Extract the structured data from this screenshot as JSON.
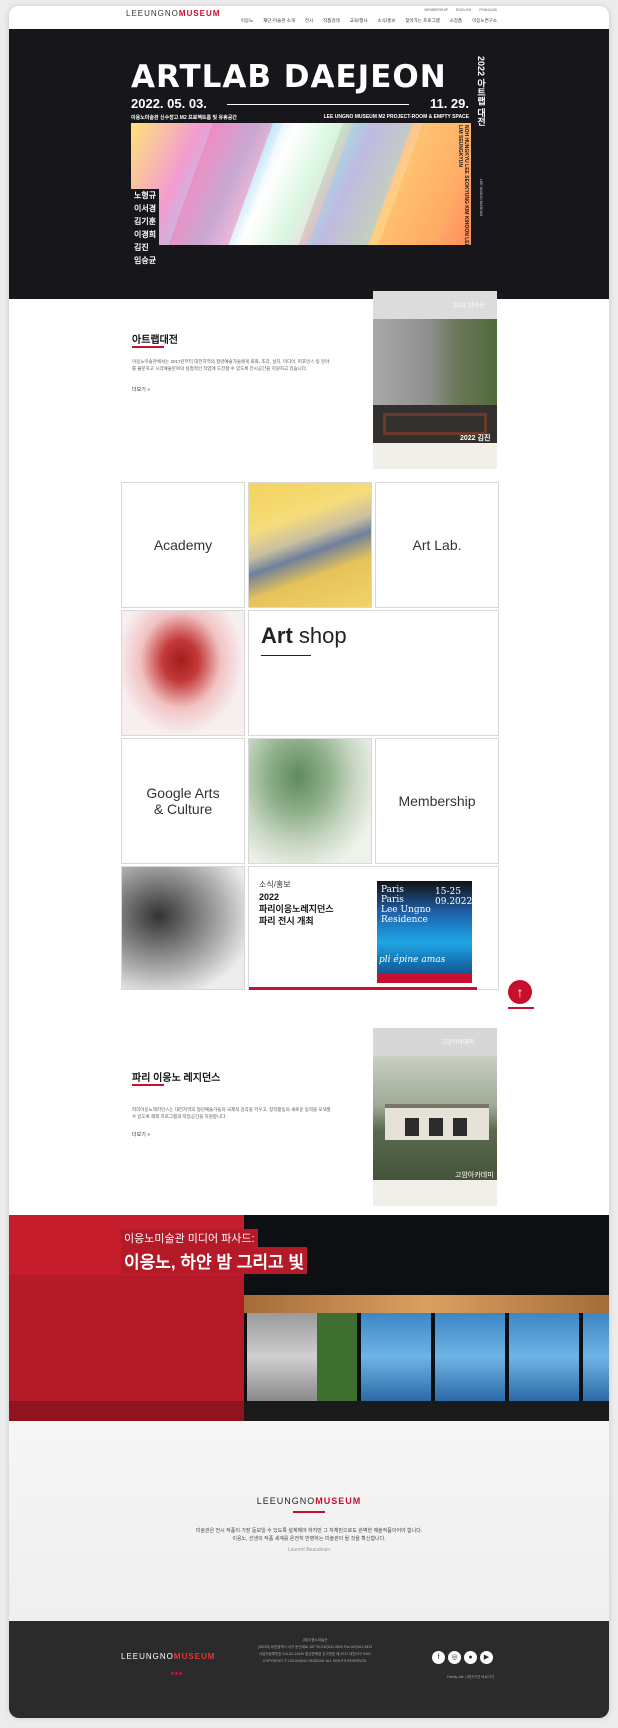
{
  "header": {
    "logo_prefix": "LEEUNGNO",
    "logo_suffix": "MUSEUM",
    "top_links": [
      "MEMBERSHIP",
      "ENGLISH",
      "FRANÇAIS"
    ],
    "nav": [
      "이응노",
      "재단·미술관 소개",
      "전시",
      "작품검색",
      "교육/행사",
      "소식/홍보",
      "찾아가는 프로그램",
      "소장품",
      "이응노연구소"
    ]
  },
  "hero": {
    "title": "ARTLAB DAEJEON",
    "date_start": "2022. 05. 03.",
    "date_end": "11. 29.",
    "subtitle_left": "이응노미술관 신수장고 M2 프로젝트룸 및 유휴공간",
    "subtitle_right": "LEE UNGNO MUSEUM  M2 PROJECT-ROOM & EMPTY SPACE",
    "artists": [
      "노형규",
      "이서경",
      "김기훈",
      "이경희",
      "김진",
      "임승균"
    ],
    "vertical_title": "2022 아트랩 대전",
    "vertical_names": "NOH HUNGKYU  LEE SEOKYUNG  KIM KIHOON  LEE KYUNGHEE  KIM JIN  LIM SEUNGKYUN",
    "vertical_small": "LEE UNGNO MUSEUM"
  },
  "section1": {
    "title": "아트랩대전",
    "text": "이응노미술관에서는 2017년부터 대전지역의 청년예술가들에게 회화, 조각, 설치, 미디어, 퍼포먼스 등 분야를 불문하고 시각예술분야의 실험적인 작업에 도전할 수 있도록 전시공간을 지원하고 있습니다.",
    "more": "더보기 »",
    "photo_top_label": "2022 임승균",
    "photo_bottom_label": "2022 김진"
  },
  "grid": {
    "academy": "Academy",
    "artlab": "Art Lab.",
    "artshop_bold": "Art",
    "artshop_rest": " shop",
    "google": "Google Arts\n& Culture",
    "membership": "Membership",
    "news_kicker": "소식/홍보",
    "news_title": "2022\n파리이응노레지던스\n파리 전시 개최",
    "news_img_text_1": "Paris\nParis\nLee Ungno\nResidence",
    "news_img_text_2": "15-25\n09.2022",
    "news_img_text_3": "pli épine amas"
  },
  "scroll_top": "↑",
  "section2": {
    "title": "파리 이응노 레지던스",
    "text": "파리이응노레지던스는 대전지역의 청년예술가들의 국제적 감각을 키우고, 창작활동의 새로운 동력을 모색할 수 있도록 해외 프로그램과 작업공간을 지원합니다.",
    "more": "더보기 »",
    "photo_top_label": "고암아카데미",
    "photo_bottom_label": "고암아카데미"
  },
  "facade": {
    "kicker": "이응노미술관 미디어 파사드:",
    "title": "이응노, 하얀 밤 그리고 빛"
  },
  "quote": {
    "logo_prefix": "LEEUNGNO",
    "logo_suffix": "MUSEUM",
    "line1": "미술관은 전시 작품이 가장 돋보일 수 있도록 설계해야 하지만 그 자체만으로도 완벽한 예술작품이어야 합니다.",
    "line2": "이응노, 선생의 작품 세계를 온전히 반영하는 미술관이 될 것을 확신합니다.",
    "author": "Laurent Beaudouin"
  },
  "footer": {
    "logo_prefix": "LEEUNGNO",
    "logo_suffix": "MUSEUM",
    "info_lines": [
      "(재)이응노미술관",
      "(35203) 대전광역시 서구 둔산대로 157    Tel 042)611-9800    Fax 042)611-9819",
      "사업자등록번호 314-82-13640    통신판매업 신고번호 제 2017-대전서구-0451",
      "COPYRIGHT © LEEUNGNO MUSEUM. ALL RIGHTS RESERVED."
    ],
    "social_icons": [
      "facebook-icon",
      "instagram-icon",
      "chat-icon",
      "youtube-icon"
    ],
    "family_site": "Family site  |  재단/기관 바로가기"
  }
}
